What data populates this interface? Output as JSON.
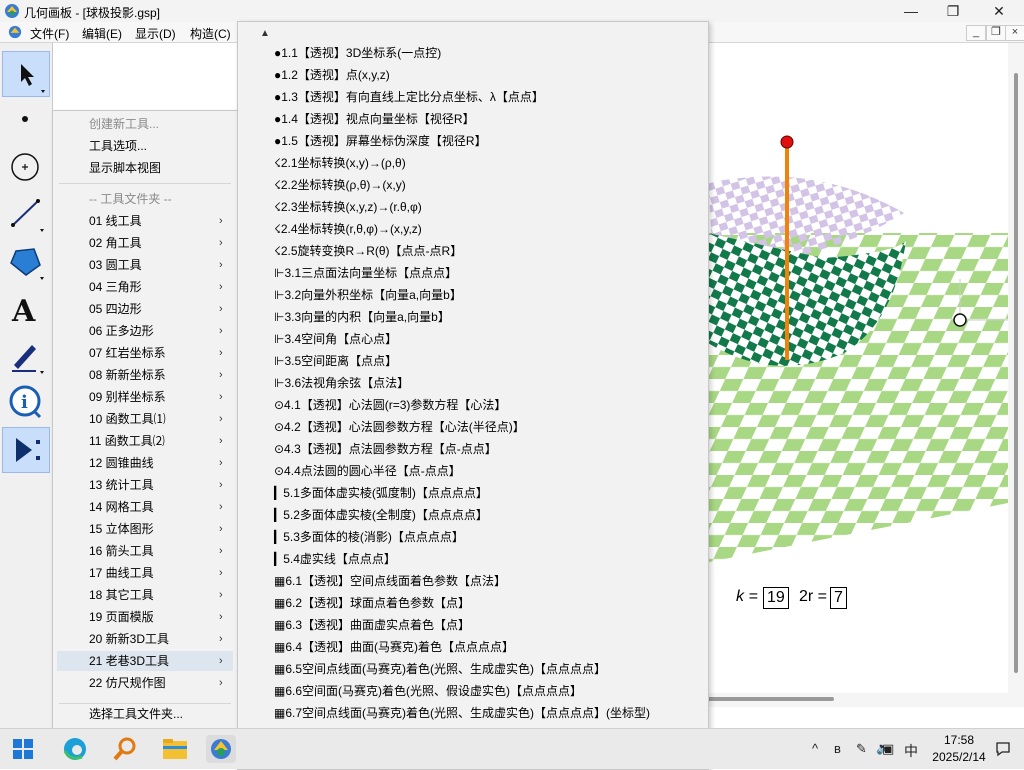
{
  "window": {
    "title": "几何画板 - [球极投影.gsp]",
    "controls": [
      "—",
      "❐",
      "✕"
    ]
  },
  "menubar": {
    "items": [
      "文件(F)",
      "编辑(E)",
      "显示(D)",
      "构造(C)"
    ],
    "mdi_controls": [
      "_",
      "❐",
      "×"
    ]
  },
  "toolbar": {
    "tools": [
      "select-arrow",
      "point",
      "compass",
      "straightedge",
      "polygon",
      "text",
      "marker",
      "information",
      "custom-tools"
    ],
    "text_tool_glyph": "A"
  },
  "tool_menu": {
    "top_items": [
      "创建新工具...",
      "工具选项...",
      "显示脚本视图"
    ],
    "folder_header": "-- 工具文件夹 --",
    "folders": [
      "01 线工具",
      "02 角工具",
      "03 圆工具",
      "04 三角形",
      "05 四边形",
      "06 正多边形",
      "07 红岩坐标系",
      "08 新新坐标系",
      "09 别样坐标系",
      "10 函数工具⑴",
      "11 函数工具⑵",
      "12 圆锥曲线",
      "13 统计工具",
      "14 网格工具",
      "15 立体图形",
      "16 箭头工具",
      "17 曲线工具",
      "18 其它工具",
      "19 页面模版",
      "20 新新3D工具",
      "21 老巷3D工具",
      "22 仿尺规作图"
    ],
    "bottom_item": "选择工具文件夹...",
    "submenu_arrow": "›"
  },
  "submenu": {
    "scroll_up": "▲",
    "scroll_down": "▼",
    "items": [
      "●1.1【透视】3D坐标系(一点控)",
      "●1.2【透视】点(x,y,z)",
      "●1.3【透视】有向直线上定比分点坐标、λ【点点】",
      "●1.4【透视】视点向量坐标【视径R】",
      "●1.5【透视】屏幕坐标伪深度【视径R】",
      "☇2.1坐标转换(x,y)→(ρ,θ)",
      "☇2.2坐标转换(ρ,θ)→(x,y)",
      "☇2.3坐标转换(x,y,z)→(r.θ,φ)",
      "☇2.4坐标转换(r,θ,φ)→(x,y,z)",
      "☇2.5旋转变换R→R(θ)【点点-点R】",
      "⊩3.1三点面法向量坐标【点点点】",
      "⊩3.2向量外积坐标【向量a,向量b】",
      "⊩3.3向量的内积【向量a,向量b】",
      "⊩3.4空间角【点心点】",
      "⊩3.5空间距离【点点】",
      "⊩3.6法视角余弦【点法】",
      "⊙4.1【透视】心法圆(r=3)参数方程【心法】",
      "⊙4.2【透视】心法圆参数方程【心法(半径点)】",
      "⊙4.3【透视】点法圆参数方程【点-点点】",
      "⊙4.4点法圆的圆心半径【点-点点】",
      "▎5.1多面体虚实棱(弧度制)【点点点点】",
      "▎5.2多面体虚实棱(全制度)【点点点点】",
      "▎5.3多面体的棱(消影)【点点点点】",
      "▎5.4虚实线【点点点】",
      "▦6.1【透视】空间点线面着色参数【点法】",
      "▦6.2【透视】球面点着色参数【点】",
      "▦6.3【透视】曲面虚实点着色【点】",
      "▦6.4【透视】曲面(马赛克)着色【点点点点】",
      "▦6.5空间点线面(马赛克)着色(光照、生成虚实色)【点点点点】",
      "▦6.6空间面(马赛克)着色(光照、假设虚实色)【点点点点】",
      "▦6.7空间点线面(马赛克)着色(光照、生成虚实色)【点点点点】(坐标型)",
      "▦6.8空间点HSV着色(光照)【点点点,控件】"
    ]
  },
  "canvas": {
    "param_k_label": "k =",
    "param_k_value": "19",
    "param_r_label": "2r =",
    "param_r_value": "7",
    "colors": {
      "sphere_dark": "#127a4a",
      "sphere_light_checker": "#d3c3e6",
      "plane_checker": "#a8d883",
      "axis_rod": "#f0820a",
      "top_point": "#e01010"
    }
  },
  "taskbar": {
    "apps": [
      "windows-start-icon",
      "edge-browser-icon",
      "search-magnifier-icon",
      "file-explorer-icon",
      "geometer-sketchpad-icon"
    ],
    "tray": [
      "^",
      "ʙ",
      "✎",
      "🔈",
      "▣",
      "中"
    ],
    "time": "17:58",
    "date": "2025/2/14"
  }
}
